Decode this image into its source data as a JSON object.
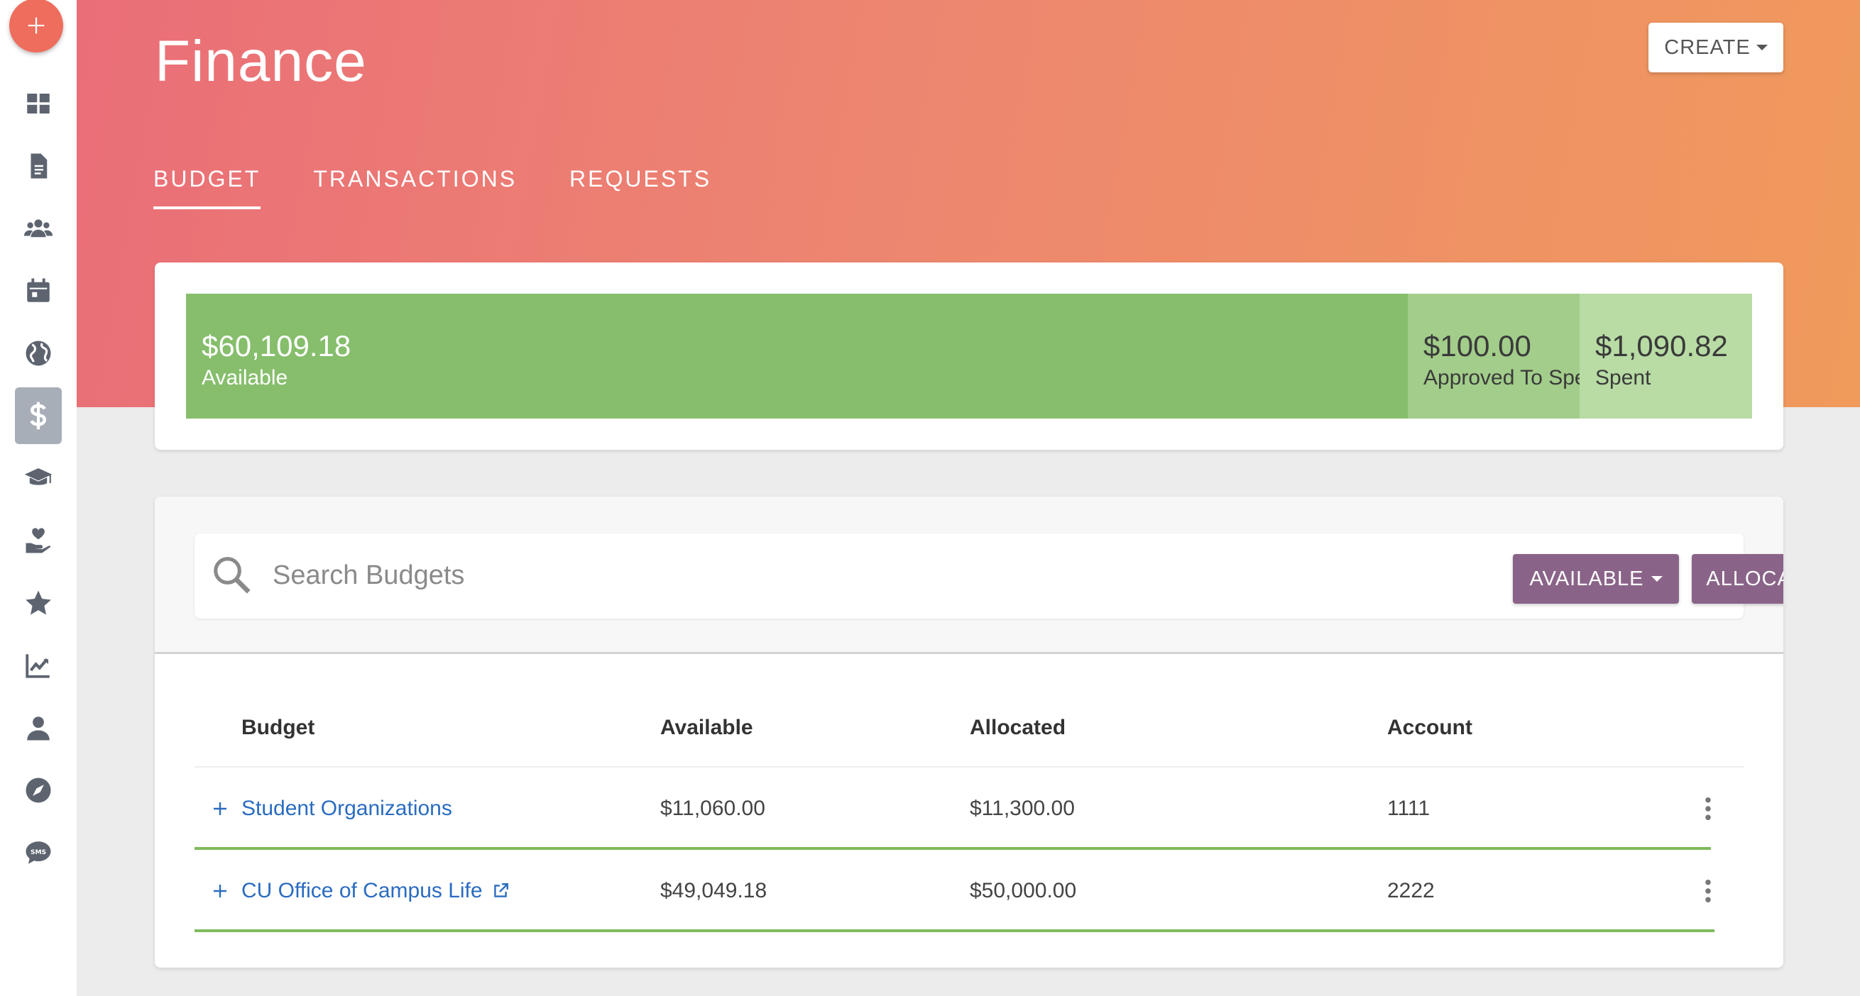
{
  "fab": {
    "icon": "plus-icon"
  },
  "sidebar": {
    "items": [
      {
        "name": "dashboard",
        "icon": "dashboard-icon"
      },
      {
        "name": "documents",
        "icon": "document-icon"
      },
      {
        "name": "groups",
        "icon": "users-icon"
      },
      {
        "name": "calendar",
        "icon": "calendar-icon"
      },
      {
        "name": "globe",
        "icon": "globe-icon"
      },
      {
        "name": "finance",
        "icon": "dollar-icon",
        "active": true
      },
      {
        "name": "education",
        "icon": "graduation-cap-icon"
      },
      {
        "name": "service",
        "icon": "hand-heart-icon"
      },
      {
        "name": "favorites",
        "icon": "star-icon"
      },
      {
        "name": "analytics",
        "icon": "chart-icon"
      },
      {
        "name": "profile",
        "icon": "person-icon"
      },
      {
        "name": "explore",
        "icon": "compass-icon"
      },
      {
        "name": "sms",
        "icon": "sms-icon"
      }
    ]
  },
  "header": {
    "title": "Finance",
    "create_label": "CREATE",
    "tabs": [
      {
        "label": "BUDGET",
        "active": true
      },
      {
        "label": "TRANSACTIONS"
      },
      {
        "label": "REQUESTS"
      }
    ]
  },
  "summary": {
    "available": {
      "amount": "$60,109.18",
      "label": "Available"
    },
    "approved": {
      "amount": "$100.00",
      "label": "Approved To Spend"
    },
    "spent": {
      "amount": "$1,090.82",
      "label": "Spent"
    }
  },
  "search": {
    "placeholder": "Search Budgets",
    "value": "",
    "available_label": "AVAILABLE",
    "allocated_label": "ALLOCATED"
  },
  "table": {
    "headers": [
      "Budget",
      "Available",
      "Allocated",
      "Account"
    ],
    "rows": [
      {
        "budget": "Student Organizations",
        "available": "$11,060.00",
        "allocated": "$11,300.00",
        "account": "1111",
        "external": false,
        "usage_fraction": 0.979
      },
      {
        "budget": "CU Office of Campus Life",
        "available": "$49,049.18",
        "allocated": "$50,000.00",
        "account": "2222",
        "external": true,
        "usage_fraction": 0.981
      }
    ]
  },
  "colors": {
    "accent": "#8a6488",
    "available": "#86be6c",
    "approved": "#a2cd8a",
    "spent": "#b8dca4",
    "link": "#2a6cc0"
  }
}
